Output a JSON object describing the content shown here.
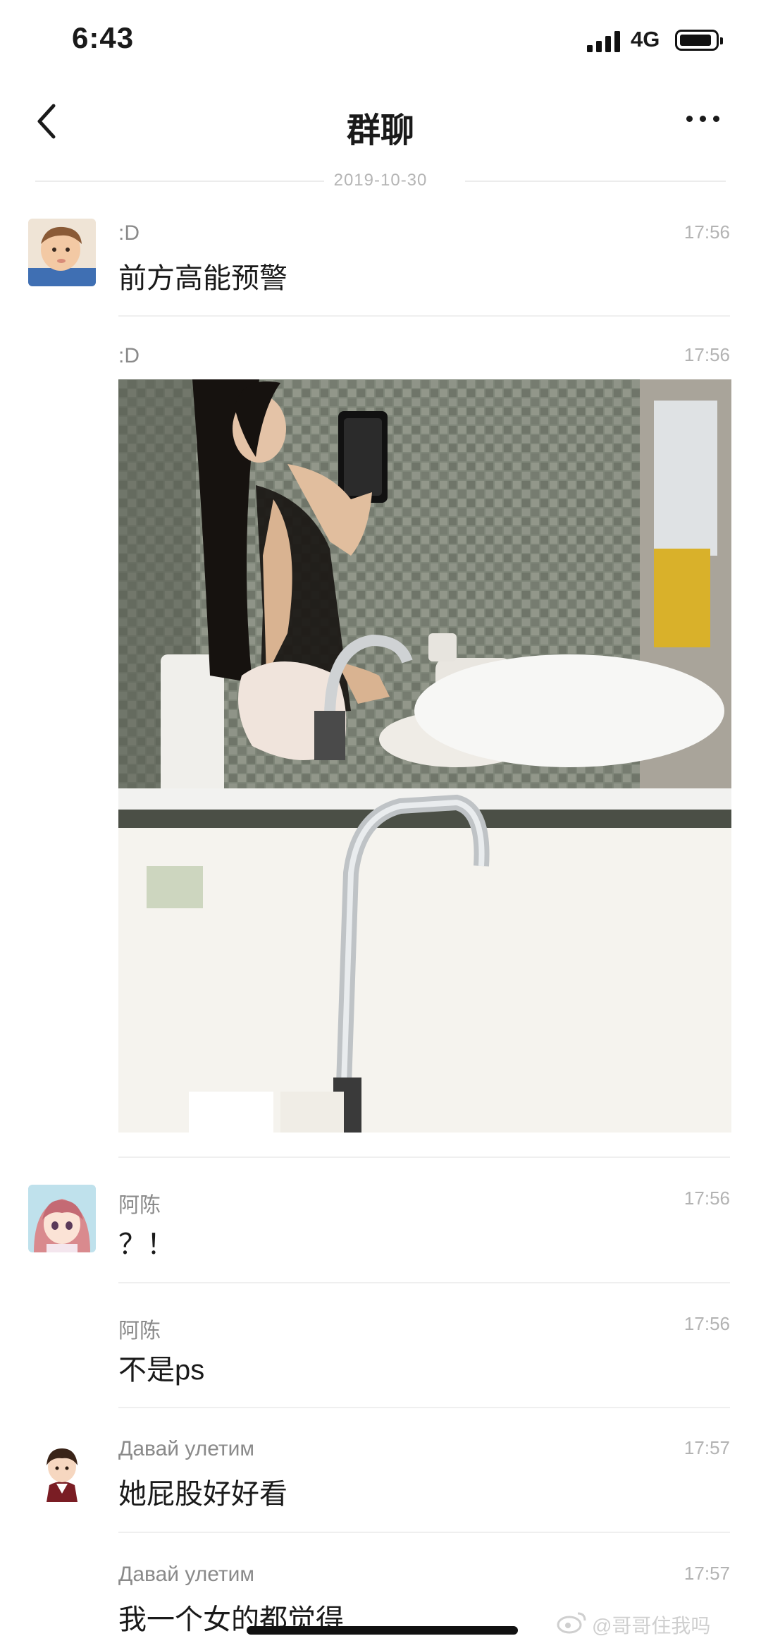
{
  "status_bar": {
    "time": "6:43",
    "network": "4G"
  },
  "nav": {
    "title": "群聊"
  },
  "date_divider": "2019-10-30",
  "messages": [
    {
      "sender": ":D",
      "time": "17:56",
      "text": "前方高能预警"
    },
    {
      "sender": ":D",
      "time": "17:56"
    },
    {
      "sender": "阿陈",
      "time": "17:56",
      "text": "？！"
    },
    {
      "sender": "阿陈",
      "time": "17:56",
      "text": "不是ps"
    },
    {
      "sender": "Давай улетим",
      "time": "17:57",
      "text": "她屁股好好看"
    },
    {
      "sender": "Давай улетим",
      "time": "17:57",
      "text": "我一个女的都觉得"
    }
  ],
  "watermark": "@哥哥住我吗",
  "colors": {
    "background": "#ffffff",
    "text": "#1a1a1a",
    "meta": "#8a8a8a",
    "divider": "#efefef"
  },
  "icons": [
    "signal-icon",
    "battery-icon",
    "back-chevron-icon",
    "more-dots-icon",
    "weibo-logo-icon"
  ]
}
